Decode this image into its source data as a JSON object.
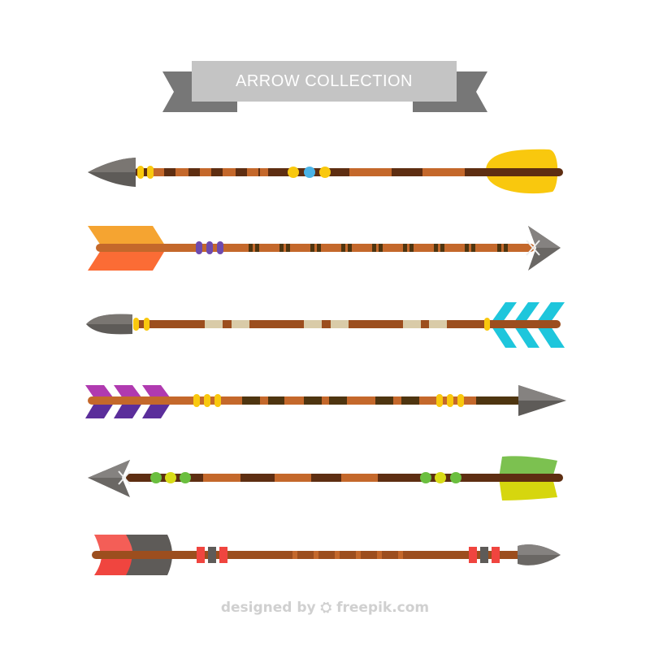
{
  "banner": {
    "title": "ARROW COLLECTION",
    "colors": {
      "ribbon": "#C4C4C4",
      "tails": "#777777"
    }
  },
  "arrows": [
    {
      "name": "arrow-1",
      "fletching_colors": [
        "#F9C80E"
      ],
      "bead_colors": [
        "#F9C80E",
        "#4AB3E6",
        "#F9C80E"
      ]
    },
    {
      "name": "arrow-2",
      "fletching_colors": [
        "#F5A431",
        "#FB6C35"
      ],
      "bead_colors": [
        "#6E4AAE"
      ]
    },
    {
      "name": "arrow-3",
      "fletching_colors": [
        "#1EC6DC"
      ],
      "bead_colors": [
        "#F9C80E"
      ]
    },
    {
      "name": "arrow-4",
      "fletching_colors": [
        "#B03AB0",
        "#5B2E9B"
      ],
      "bead_colors": [
        "#F9C80E"
      ]
    },
    {
      "name": "arrow-5",
      "fletching_colors": [
        "#7CC150",
        "#D6D60E"
      ],
      "bead_colors": [
        "#6BBF3F",
        "#D8DC18"
      ]
    },
    {
      "name": "arrow-6",
      "fletching_colors": [
        "#F0453F",
        "#5E5B58"
      ],
      "bead_colors": [
        "#F0453F",
        "#5E5B58"
      ]
    }
  ],
  "footer": {
    "credit": "designed by ⛭ freepik.com"
  }
}
